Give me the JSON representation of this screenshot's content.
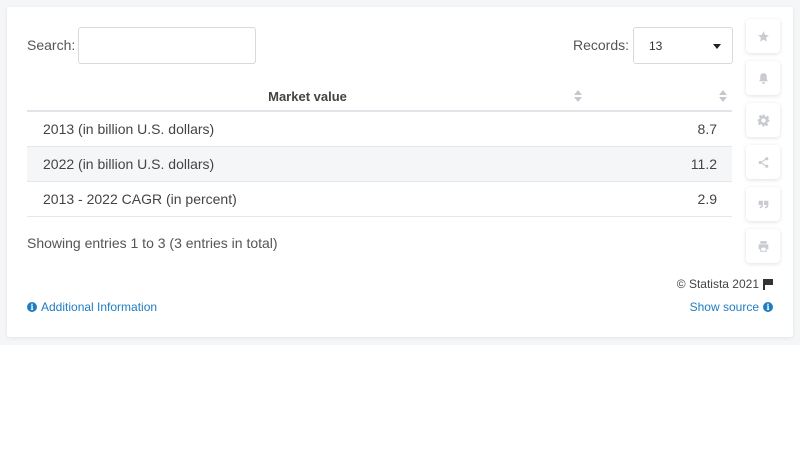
{
  "search": {
    "label": "Search:",
    "value": "",
    "placeholder": ""
  },
  "records": {
    "label": "Records:",
    "selected": "13"
  },
  "table": {
    "header": "Market value",
    "rows": [
      {
        "label": "2013 (in billion U.S. dollars)",
        "value": "8.7"
      },
      {
        "label": "2022 (in billion U.S. dollars)",
        "value": "11.2"
      },
      {
        "label": "2013 - 2022 CAGR (in percent)",
        "value": "2.9"
      }
    ]
  },
  "entries_info": "Showing entries 1 to 3 (3 entries in total)",
  "footer": {
    "copyright": "© Statista 2021",
    "additional_info": "Additional Information",
    "show_source": "Show source"
  },
  "toolbar": [
    "star-icon",
    "bell-icon",
    "gear-icon",
    "share-icon",
    "quote-icon",
    "print-icon"
  ],
  "colors": {
    "link": "#1f7dc2",
    "row_alt": "#f4f6f8",
    "icon": "#c8ccd1"
  }
}
